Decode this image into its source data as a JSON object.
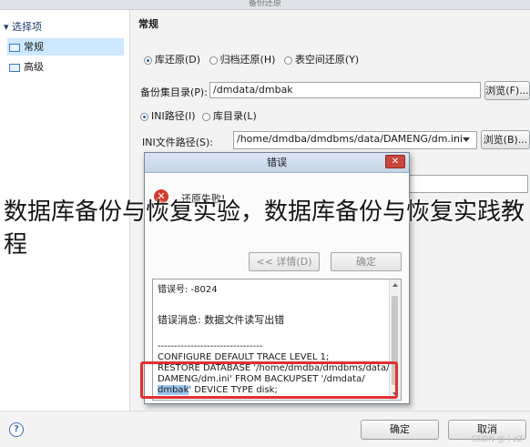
{
  "window": {
    "title": "备份还原"
  },
  "sidebar": {
    "heading": "▾ 选择项",
    "items": [
      {
        "label": "常规",
        "selected": true
      },
      {
        "label": "高级",
        "selected": false
      }
    ]
  },
  "main": {
    "section_title": "常规",
    "restore_types": [
      {
        "label": "库还原(D)",
        "checked": true
      },
      {
        "label": "归档还原(H)",
        "checked": false
      },
      {
        "label": "表空间还原(Y)",
        "checked": false
      }
    ],
    "backup_dir": {
      "label": "备份集目录(P):",
      "value": "/dmdata/dmbak",
      "browse_label": "浏览(F)..."
    },
    "path_types": [
      {
        "label": "INI路径(I)",
        "checked": true
      },
      {
        "label": "库目录(L)",
        "checked": false
      }
    ],
    "ini_path": {
      "label": "INI文件路径(S):",
      "value": "/home/dmdba/dmdbms/data/DAMENG/dm.ini",
      "browse_label": "浏览(B)..."
    }
  },
  "dialog": {
    "title": "错误",
    "close_glyph": "✕",
    "icon_glyph": "✕",
    "message": "还原失败!",
    "details_button": "<< 详情(D)",
    "ok_button": "确定",
    "details": {
      "error_code": "错误号: -8024",
      "error_message": "错误消息: 数据文件读写出错",
      "separator": "--------------------------------",
      "trace_level": "CONFIGURE DEFAULT TRACE LEVEL 1;",
      "sql_line1": "RESTORE DATABASE '/home/dmdba/dmdbms/data/",
      "sql_line2": "DAMENG/dm.ini' FROM BACKUPSET '/dmdata/",
      "sql_line3_sel": "dmbak",
      "sql_line3_rest": "' DEVICE TYPE disk;"
    }
  },
  "overlay_caption": "数据库备份与恢复实验，数据库备份与恢复实践教程",
  "footer": {
    "help_glyph": "?",
    "ok_label": "确定",
    "cancel_label": "取消",
    "watermark": "CSDN @ l zZ"
  },
  "colors": {
    "highlight_border": "#e03030",
    "selection": "#cde8ff",
    "close_button": "#c9463d"
  }
}
